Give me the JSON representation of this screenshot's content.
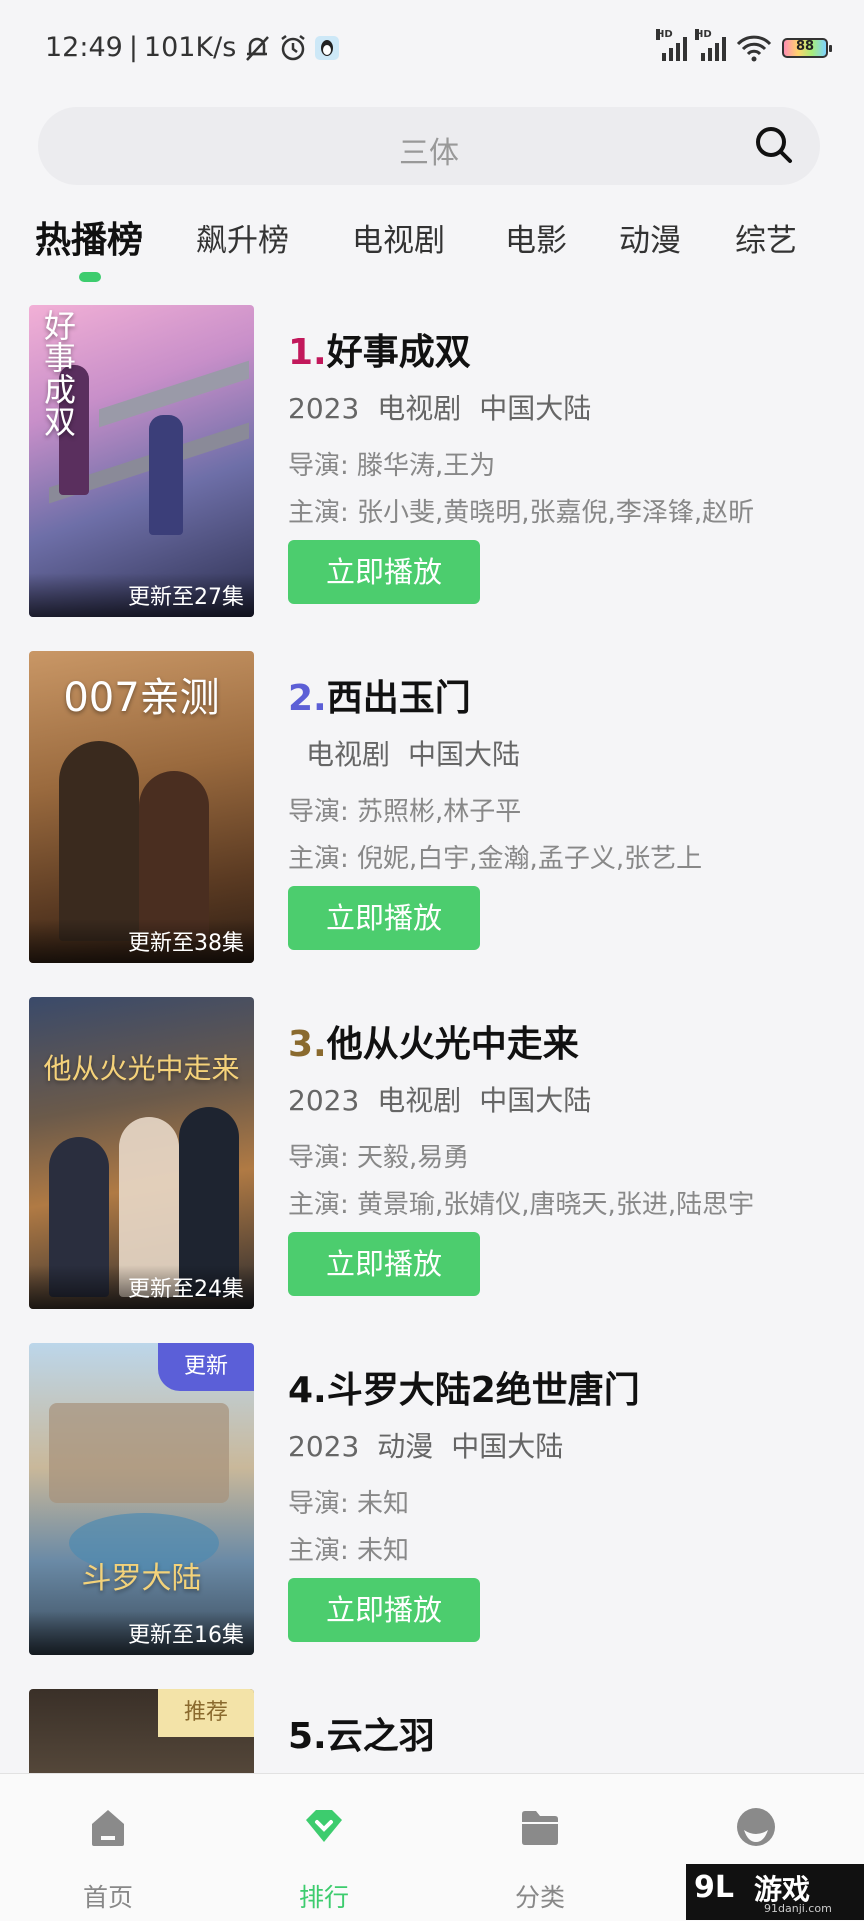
{
  "status_bar": {
    "time": "12:49",
    "divider": "|",
    "speed": "101K/s",
    "battery": "88",
    "signal_label": "HD"
  },
  "search": {
    "placeholder": "三体"
  },
  "tabs": [
    "热播榜",
    "飙升榜",
    "电视剧",
    "电影",
    "动漫",
    "综艺"
  ],
  "active_tab_index": 0,
  "play_label": "立即播放",
  "items": [
    {
      "rank": "1.",
      "rank_color": "#c2185b",
      "title": "好事成双",
      "year": "2023",
      "type": "电视剧",
      "region": "中国大陆",
      "director": "导演: 滕华涛,王为",
      "cast": "主演: 张小斐,黄晓明,张嘉倪,李泽锋,赵昕",
      "update": "更新至27集",
      "poster_text": "好事成双",
      "badge": ""
    },
    {
      "rank": "2.",
      "rank_color": "#5c5fd6",
      "title": "西出玉门",
      "year": "",
      "type": "电视剧",
      "region": "中国大陆",
      "director": "导演: 苏照彬,林子平",
      "cast": "主演: 倪妮,白宇,金瀚,孟子义,张艺上",
      "update": "更新至38集",
      "poster_text": "007亲测",
      "badge": ""
    },
    {
      "rank": "3.",
      "rank_color": "#8a6a2e",
      "title": "他从火光中走来",
      "year": "2023",
      "type": "电视剧",
      "region": "中国大陆",
      "director": "导演: 天毅,易勇",
      "cast": "主演: 黄景瑜,张婧仪,唐晓天,张进,陆思宇",
      "update": "更新至24集",
      "poster_text": "他从火光中走来",
      "badge": ""
    },
    {
      "rank": "4.",
      "rank_color": "#111111",
      "title": "斗罗大陆2绝世唐门",
      "year": "2023",
      "type": "动漫",
      "region": "中国大陆",
      "director": "导演: 未知",
      "cast": "主演: 未知",
      "update": "更新至16集",
      "poster_text": "斗罗大陆",
      "badge": "更新"
    },
    {
      "rank": "5.",
      "rank_color": "#111111",
      "title": "云之羽",
      "year": "",
      "type": "",
      "region": "",
      "director": "",
      "cast": "",
      "update": "",
      "poster_text": "",
      "badge": "推荐"
    }
  ],
  "watermark_overlay": {
    "text": "91游戏"
  },
  "bottom_nav": [
    {
      "label": "首页",
      "icon": "home-icon"
    },
    {
      "label": "排行",
      "icon": "ranking-icon"
    },
    {
      "label": "分类",
      "icon": "folder-icon"
    },
    {
      "label": "",
      "icon": "profile-icon"
    }
  ],
  "watermark": {
    "logo": "9L",
    "name": "游戏",
    "url": "91danji.com"
  },
  "colors": {
    "accent": "#4ccd6e",
    "badge_update": "#5b5fd8",
    "badge_recommend": "#f3e3a8"
  }
}
